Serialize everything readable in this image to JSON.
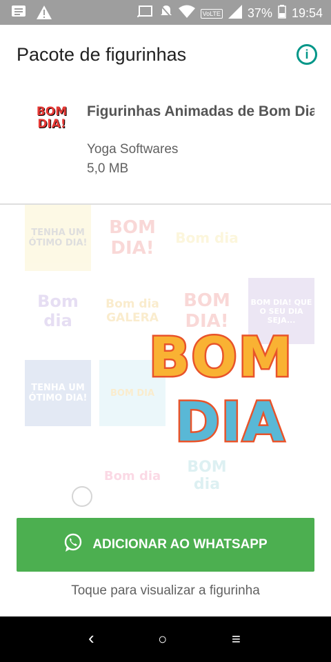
{
  "status_bar": {
    "battery": "37%",
    "time": "19:54",
    "volte": "VoLTE"
  },
  "header": {
    "title": "Pacote de figurinhas"
  },
  "pack": {
    "thumb_line1": "BOM",
    "thumb_line2": "DIA!",
    "name": "Figurinhas Animadas de Bom Dia",
    "author": "Yoga Softwares",
    "size": "5,0 MB"
  },
  "stickers": [
    {
      "text": "TENHA UM ÓTIMO DIA!",
      "bg": "#f7e07a",
      "color": "#555555"
    },
    {
      "text": "BOM DIA!",
      "bg": "#ffffff",
      "color": "#e53935"
    },
    {
      "text": "Bom dia",
      "bg": "#ffffff",
      "color": "#f3d24e"
    },
    {
      "text": "Bom dia",
      "bg": "#ffffff",
      "color": "#7e57c2"
    },
    {
      "text": "Bom dia GALERA",
      "bg": "#ffffff",
      "color": "#e6a000"
    },
    {
      "text": "BOM DIA!",
      "bg": "#ffffff",
      "color": "#e53935"
    },
    {
      "text": "BOM DIA! QUE O SEU DIA SEJA...",
      "bg": "#9c7fc7",
      "color": "#ffffff"
    },
    {
      "text": "TENHA UM ÓTIMO DIA!",
      "bg": "#6f8fc9",
      "color": "#ffffff"
    },
    {
      "text": "BOM DIA",
      "bg": "#9ad7e8",
      "color": "#e6a000"
    },
    {
      "text": "Bom dia",
      "bg": "#ffffff",
      "color": "#ec407a"
    },
    {
      "text": "BOM dia",
      "bg": "#ffffff",
      "color": "#4fb3bf"
    }
  ],
  "preview": {
    "line1": "BOM",
    "line2": "DIA"
  },
  "add_button": {
    "label": "ADICIONAR AO WHATSAPP"
  },
  "hint": "Toque para visualizar a figurinha",
  "nav": {
    "back": "‹",
    "home": "○",
    "recents": "≡"
  },
  "colors": {
    "accent": "#009688",
    "button": "#4caf50"
  }
}
